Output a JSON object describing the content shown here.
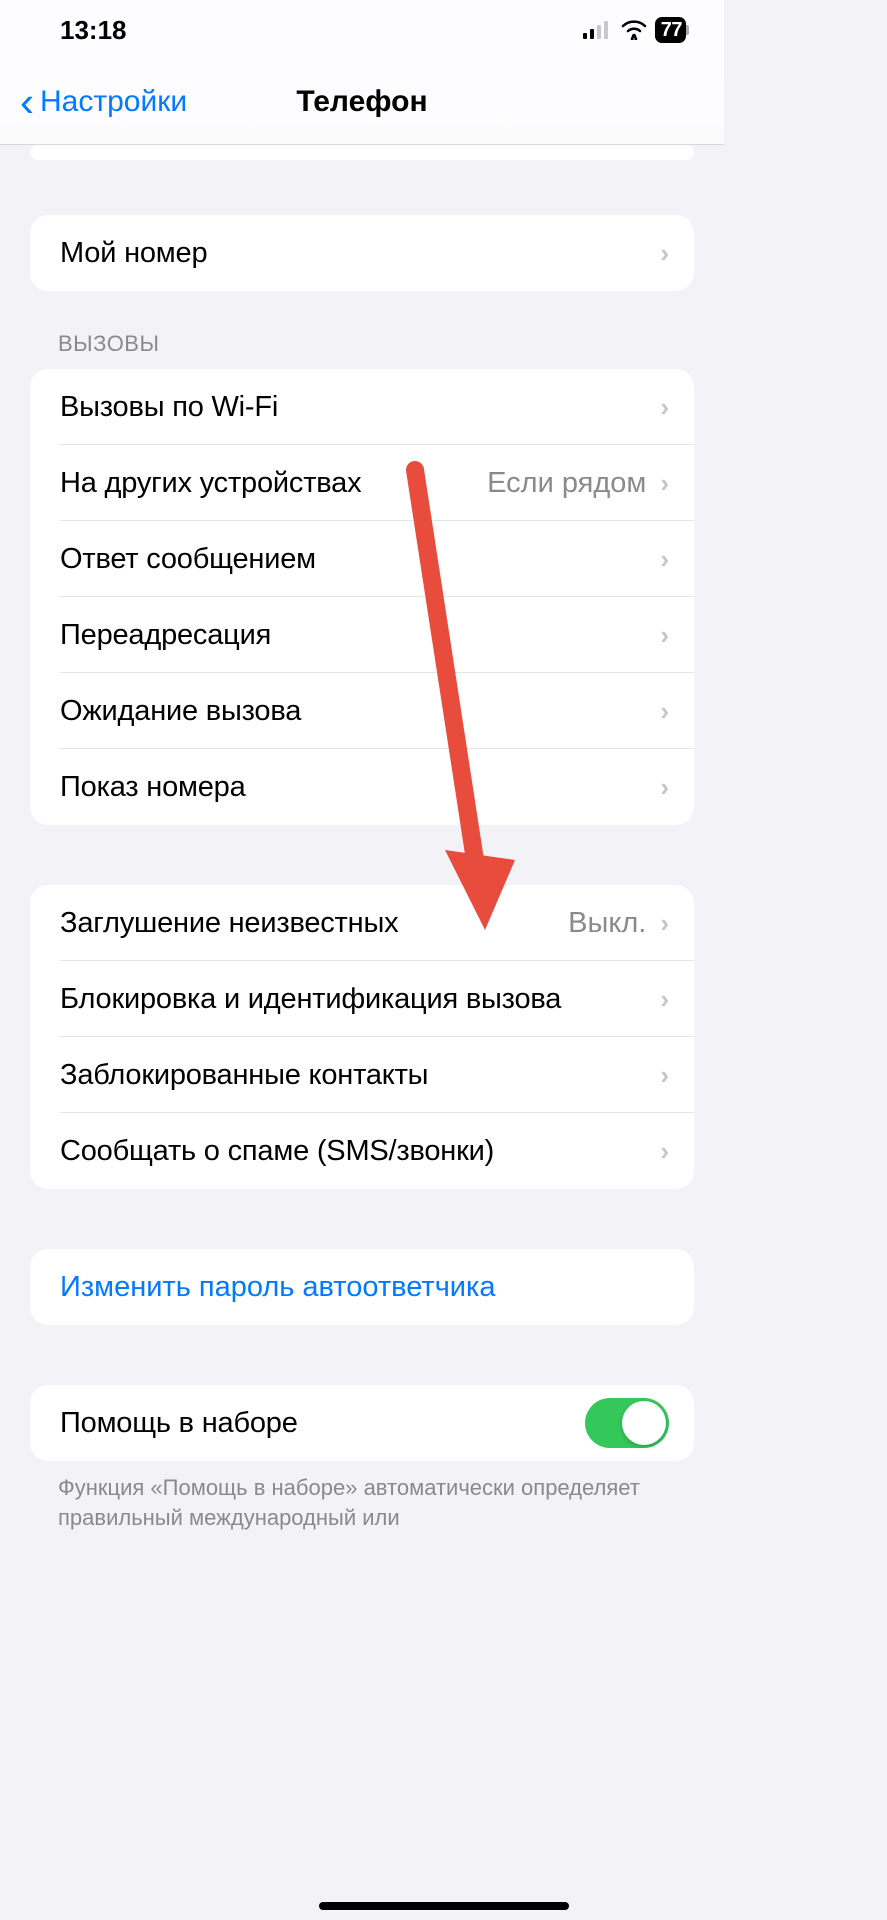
{
  "status": {
    "time": "13:18",
    "battery": "77"
  },
  "nav": {
    "back": "Настройки",
    "title": "Телефон"
  },
  "section1": {
    "my_number": "Мой номер"
  },
  "calls": {
    "header": "ВЫЗОВЫ",
    "wifi_calling": "Вызовы по Wi-Fi",
    "other_devices": "На других устройствах",
    "other_devices_value": "Если рядом",
    "reply_message": "Ответ сообщением",
    "call_forwarding": "Переадресация",
    "call_waiting": "Ожидание вызова",
    "show_caller_id": "Показ номера"
  },
  "block": {
    "silence_unknown": "Заглушение неизвестных",
    "silence_unknown_value": "Выкл.",
    "block_id": "Блокировка и идентификация вызова",
    "blocked_contacts": "Заблокированные контакты",
    "report_spam": "Сообщать о спаме (SMS/звонки)"
  },
  "voicemail": {
    "change_password": "Изменить пароль автоответчика"
  },
  "dial_assist": {
    "label": "Помощь в наборе",
    "footer": "Функция «Помощь в наборе» автоматически определяет правильный международный или"
  }
}
